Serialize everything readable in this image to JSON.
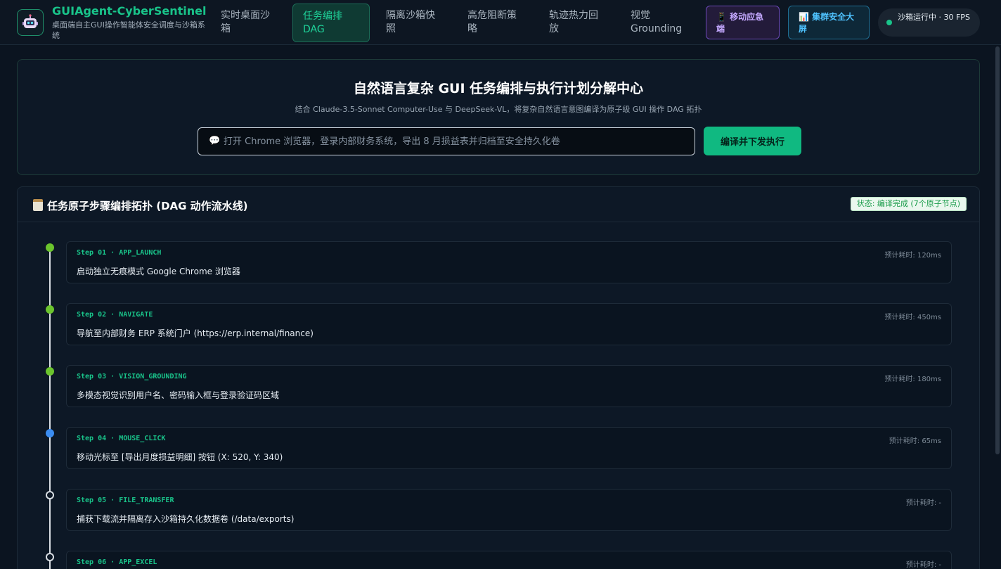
{
  "header": {
    "brand_title": "GUIAgent-CyberSentinel",
    "brand_subtitle": "桌面端自主GUI操作智能体安全调度与沙箱系统",
    "logo_icon": "robot-icon",
    "nav": [
      {
        "label": "实时桌面沙箱",
        "active": false
      },
      {
        "label": "任务编排 DAG",
        "active": true
      },
      {
        "label": "隔离沙箱快照",
        "active": false
      },
      {
        "label": "高危阻断策略",
        "active": false
      },
      {
        "label": "轨迹热力回放",
        "active": false
      },
      {
        "label": "视觉 Grounding",
        "active": false
      }
    ],
    "mobile_button": "📱 移动应急端",
    "cluster_button": "📊 集群安全大屏",
    "status_text": "沙箱运行中 · 30 FPS"
  },
  "hero": {
    "title": "自然语言复杂 GUI 任务编排与执行计划分解中心",
    "subtitle": "结合 Claude-3.5-Sonnet Computer-Use 与 DeepSeek-VL，将复杂自然语言意图编译为原子级 GUI 操作 DAG 拓扑",
    "input_icon": "💬",
    "input_placeholder": "打开 Chrome 浏览器，登录内部财务系统，导出 8 月损益表并归档至安全持久化卷",
    "submit_label": "编译并下发执行"
  },
  "panel": {
    "title": "任务原子步骤编排拓扑 (DAG 动作流水线)",
    "title_icon": "clipboard-icon",
    "status_badge": "状态: 编译完成 (7个原子节点)"
  },
  "steps": [
    {
      "tag": "Step 01 · APP_LAUNCH",
      "time": "预计耗时: 120ms",
      "desc": "启动独立无痕模式 Google Chrome 浏览器",
      "state": "done"
    },
    {
      "tag": "Step 02 · NAVIGATE",
      "time": "预计耗时: 450ms",
      "desc": "导航至内部财务 ERP 系统门户 (https://erp.internal/finance)",
      "state": "done"
    },
    {
      "tag": "Step 03 · VISION_GROUNDING",
      "time": "预计耗时: 180ms",
      "desc": "多模态视觉识别用户名、密码输入框与登录验证码区域",
      "state": "done"
    },
    {
      "tag": "Step 04 · MOUSE_CLICK",
      "time": "预计耗时: 65ms",
      "desc": "移动光标至 [导出月度损益明细] 按钮 (X: 520, Y: 340)",
      "state": "active"
    },
    {
      "tag": "Step 05 · FILE_TRANSFER",
      "time": "预计耗时: -",
      "desc": "捕获下载流并隔离存入沙箱持久化数据卷 (/data/exports)",
      "state": "pending"
    },
    {
      "tag": "Step 06 · APP_EXCEL",
      "time": "预计耗时: -",
      "desc": "",
      "state": "pending"
    }
  ],
  "colors": {
    "accent": "#19c48a",
    "done": "#6bc42d",
    "active": "#3b8df2",
    "pending": "#d9dee4"
  }
}
